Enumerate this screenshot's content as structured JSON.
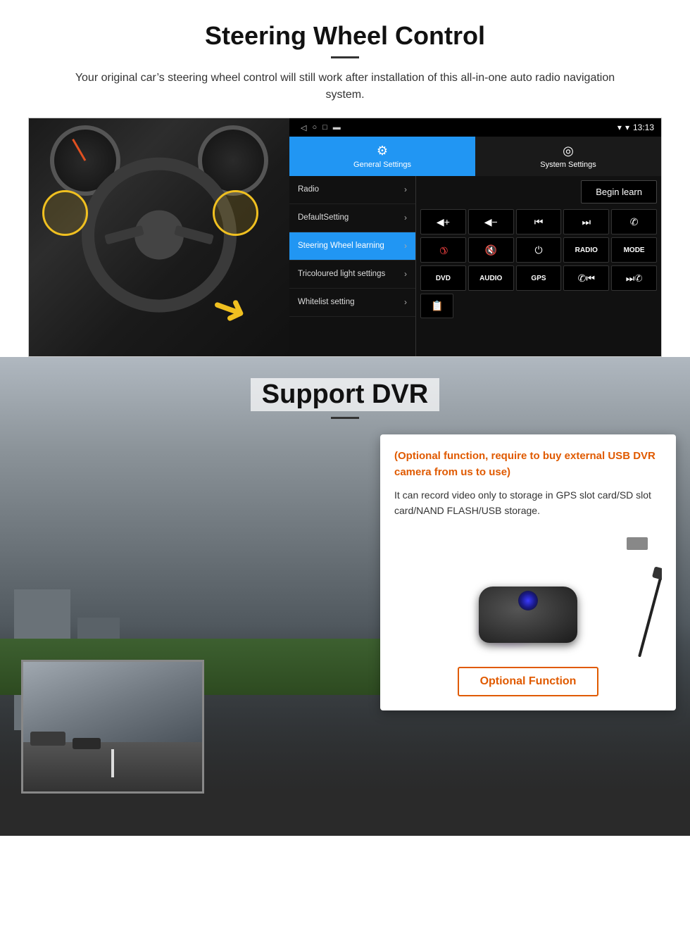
{
  "steering_section": {
    "title": "Steering Wheel Control",
    "subtitle": "Your original car’s steering wheel control will still work after installation of this all-in-one auto radio navigation system.",
    "status_bar": {
      "time": "13:13",
      "signal_icon": "▾",
      "wifi_icon": "▾",
      "battery_icon": "▮"
    },
    "tabs": [
      {
        "id": "general",
        "label": "General Settings",
        "icon": "⚙",
        "active": true
      },
      {
        "id": "system",
        "label": "System Settings",
        "icon": "◎",
        "active": false
      }
    ],
    "menu_items": [
      {
        "id": "radio",
        "label": "Radio",
        "active": false
      },
      {
        "id": "defaultsetting",
        "label": "DefaultSetting",
        "active": false
      },
      {
        "id": "steering",
        "label": "Steering Wheel learning",
        "active": true
      },
      {
        "id": "tricoloured",
        "label": "Tricoloured light settings",
        "active": false
      },
      {
        "id": "whitelist",
        "label": "Whitelist setting",
        "active": false
      }
    ],
    "begin_learn_label": "Begin learn",
    "control_buttons": [
      {
        "id": "vol_up",
        "icon": "▐+",
        "text": ""
      },
      {
        "id": "vol_down",
        "icon": "▐−",
        "text": ""
      },
      {
        "id": "prev_track",
        "icon": "⏮",
        "text": ""
      },
      {
        "id": "next_track",
        "icon": "⏭",
        "text": ""
      },
      {
        "id": "phone",
        "icon": "✆",
        "text": ""
      },
      {
        "id": "hangup",
        "icon": "☎",
        "text": ""
      },
      {
        "id": "mute",
        "icon": "🔇",
        "text": ""
      },
      {
        "id": "power",
        "icon": "⏻",
        "text": ""
      },
      {
        "id": "radio_btn",
        "icon": "",
        "text": "RADIO"
      },
      {
        "id": "mode_btn",
        "icon": "",
        "text": "MODE"
      },
      {
        "id": "dvd",
        "icon": "",
        "text": "DVD"
      },
      {
        "id": "audio",
        "icon": "",
        "text": "AUDIO"
      },
      {
        "id": "gps",
        "icon": "",
        "text": "GPS"
      },
      {
        "id": "prev_call",
        "icon": "☎⏮",
        "text": ""
      },
      {
        "id": "next_call",
        "icon": "⏭☎",
        "text": ""
      }
    ],
    "bottom_buttons": [
      {
        "id": "folder",
        "icon": "📁",
        "text": ""
      }
    ]
  },
  "dvr_section": {
    "title": "Support DVR",
    "optional_notice": "(Optional function, require to buy external USB DVR camera from us to use)",
    "description": "It can record video only to storage in GPS slot card/SD slot card/NAND FLASH/USB storage.",
    "optional_function_label": "Optional Function"
  }
}
